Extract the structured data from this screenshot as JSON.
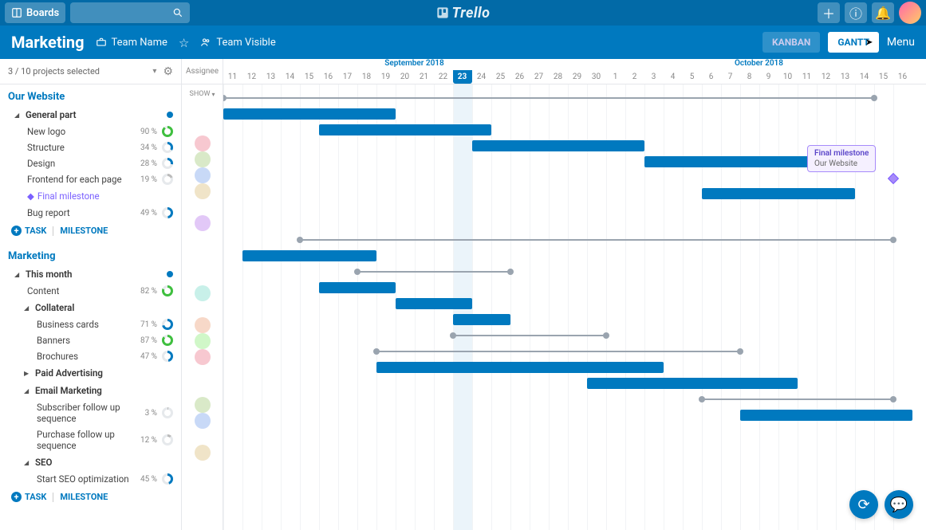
{
  "nav": {
    "boards_label": "Boards",
    "logo_text": "Trello"
  },
  "board": {
    "title": "Marketing",
    "team_label": "Team Name",
    "visibility_label": "Team Visible",
    "view_kanban": "KANBAN",
    "view_gantt": "GANTT",
    "menu_label": "Menu"
  },
  "sidebar": {
    "projects_selector": "3 / 10 projects selected",
    "assignee_header": "Assignee",
    "show_label": "SHOW",
    "add_task_label": "TASK",
    "add_milestone_label": "MILESTONE",
    "sections": [
      {
        "id": "website",
        "title": "Our Website",
        "groups": [
          {
            "name": "General part",
            "open": true,
            "dot": true,
            "tasks": [
              {
                "name": "New logo",
                "pct": "90 %",
                "color": "#3fbf3f",
                "val": 90
              },
              {
                "name": "Structure",
                "pct": "34 %",
                "color": "#0079bf",
                "val": 34
              },
              {
                "name": "Design",
                "pct": "28 %",
                "color": "#0079bf",
                "val": 28
              },
              {
                "name": "Frontend for each page",
                "pct": "19 %",
                "color": "#bbb",
                "val": 19
              }
            ],
            "milestone": {
              "label": "Final milestone"
            },
            "post_tasks": [
              {
                "name": "Bug report",
                "pct": "49 %",
                "color": "#0079bf",
                "val": 49
              }
            ]
          }
        ]
      },
      {
        "id": "marketing",
        "title": "Marketing",
        "groups": [
          {
            "name": "This month",
            "open": true,
            "dot": true,
            "tasks": [
              {
                "name": "Content",
                "pct": "82 %",
                "color": "#3fbf3f",
                "val": 82
              }
            ],
            "subgroups": [
              {
                "name": "Collateral",
                "open": true,
                "tasks": [
                  {
                    "name": "Business cards",
                    "pct": "71 %",
                    "color": "#0079bf",
                    "val": 71
                  },
                  {
                    "name": "Banners",
                    "pct": "87 %",
                    "color": "#3fbf3f",
                    "val": 87
                  },
                  {
                    "name": "Brochures",
                    "pct": "47 %",
                    "color": "#0079bf",
                    "val": 47
                  }
                ]
              },
              {
                "name": "Paid Advertising",
                "open": false,
                "tasks": []
              },
              {
                "name": "Email Marketing",
                "open": true,
                "tasks": [
                  {
                    "name": "Subscriber follow up sequence",
                    "pct": "3 %",
                    "color": "#bbb",
                    "val": 3
                  },
                  {
                    "name": "Purchase follow up sequence",
                    "pct": "12 %",
                    "color": "#bbb",
                    "val": 12
                  }
                ]
              },
              {
                "name": "SEO",
                "open": true,
                "tasks": [
                  {
                    "name": "Start SEO optimization",
                    "pct": "45 %",
                    "color": "#0079bf",
                    "val": 45
                  }
                ]
              }
            ]
          }
        ]
      }
    ]
  },
  "gantt": {
    "months": [
      {
        "label": "September 2018",
        "days": 20
      },
      {
        "label": "October 2018",
        "days": 16
      }
    ],
    "days": [
      "11",
      "12",
      "13",
      "14",
      "15",
      "16",
      "17",
      "18",
      "19",
      "20",
      "21",
      "22",
      "23",
      "24",
      "25",
      "26",
      "27",
      "28",
      "29",
      "30",
      "1",
      "2",
      "3",
      "4",
      "5",
      "6",
      "7",
      "8",
      "9",
      "10",
      "11",
      "12",
      "13",
      "14",
      "15",
      "16"
    ],
    "today_index": 12,
    "milestone_tooltip": {
      "title": "Final milestone",
      "sub": "Our Website"
    }
  },
  "chart_data": {
    "type": "gantt",
    "day_index_start_date": "2018-09-11",
    "sections": [
      {
        "name": "Our Website / General part",
        "span": {
          "start": 0,
          "end": 34
        },
        "tasks": [
          {
            "name": "New logo",
            "start": 0,
            "end": 9
          },
          {
            "name": "Structure",
            "start": 5,
            "end": 14
          },
          {
            "name": "Design",
            "start": 13,
            "end": 22
          },
          {
            "name": "Frontend for each page",
            "start": 22,
            "end": 31
          },
          {
            "name": "Bug report",
            "start": 25,
            "end": 33
          }
        ],
        "milestone": {
          "name": "Final milestone",
          "at": 35
        }
      },
      {
        "name": "Marketing / This month",
        "span": {
          "start": 4,
          "end": 35
        },
        "tasks": [
          {
            "name": "Content",
            "start": 1,
            "end": 8
          }
        ],
        "subgroups": [
          {
            "name": "Collateral",
            "span": {
              "start": 7,
              "end": 15
            },
            "tasks": [
              {
                "name": "Business cards",
                "start": 5,
                "end": 9
              },
              {
                "name": "Banners",
                "start": 9,
                "end": 13
              },
              {
                "name": "Brochures",
                "start": 12,
                "end": 15
              }
            ]
          },
          {
            "name": "Paid Advertising",
            "span": {
              "start": 12,
              "end": 20
            },
            "tasks": []
          },
          {
            "name": "Email Marketing",
            "span": {
              "start": 8,
              "end": 27
            },
            "tasks": [
              {
                "name": "Subscriber follow up sequence",
                "start": 8,
                "end": 23
              },
              {
                "name": "Purchase follow up sequence",
                "start": 19,
                "end": 30
              }
            ]
          },
          {
            "name": "SEO",
            "span": {
              "start": 25,
              "end": 35
            },
            "tasks": [
              {
                "name": "Start SEO optimization",
                "start": 27,
                "end": 36
              }
            ]
          }
        ]
      }
    ]
  }
}
